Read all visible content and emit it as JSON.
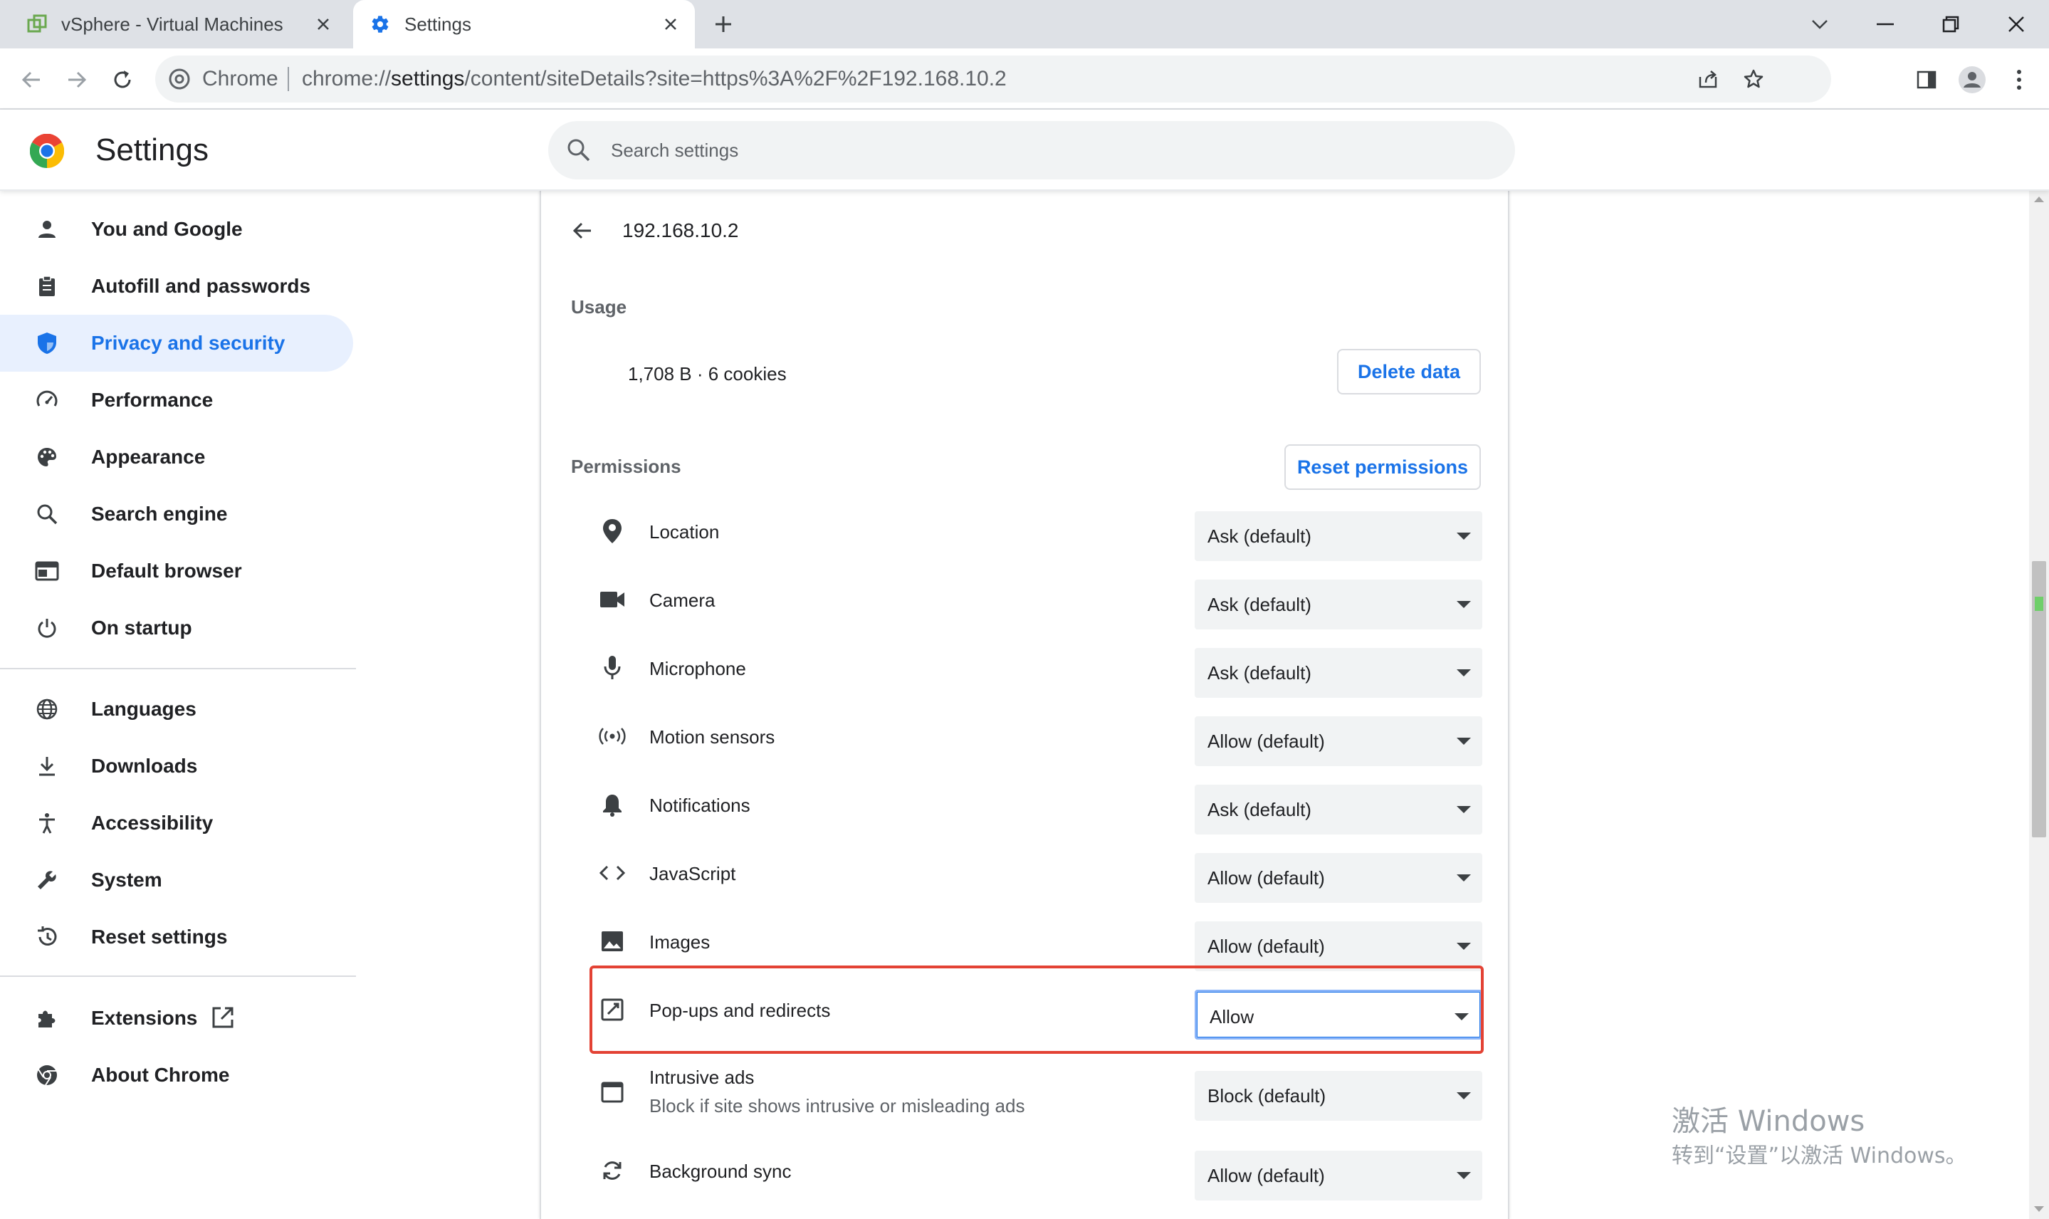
{
  "browser": {
    "tabs": [
      {
        "title": "vSphere - Virtual Machines",
        "icon": "vsphere-icon"
      },
      {
        "title": "Settings",
        "icon": "gear-icon"
      }
    ],
    "omnibox": {
      "chip": "Chrome",
      "url_host": "chrome://",
      "url_bold": "settings",
      "url_rest": "/content/siteDetails?site=https%3A%2F%2F192.168.10.2"
    }
  },
  "header": {
    "title": "Settings",
    "search_placeholder": "Search settings"
  },
  "sidebar": {
    "items": [
      {
        "label": "You and Google",
        "icon": "person-icon"
      },
      {
        "label": "Autofill and passwords",
        "icon": "clipboard-icon"
      },
      {
        "label": "Privacy and security",
        "icon": "shield-icon",
        "selected": true
      },
      {
        "label": "Performance",
        "icon": "speedometer-icon"
      },
      {
        "label": "Appearance",
        "icon": "palette-icon"
      },
      {
        "label": "Search engine",
        "icon": "search-icon"
      },
      {
        "label": "Default browser",
        "icon": "browser-window-icon"
      },
      {
        "label": "On startup",
        "icon": "power-icon"
      },
      {
        "label": "Languages",
        "icon": "globe-icon"
      },
      {
        "label": "Downloads",
        "icon": "download-icon"
      },
      {
        "label": "Accessibility",
        "icon": "accessibility-icon"
      },
      {
        "label": "System",
        "icon": "wrench-icon"
      },
      {
        "label": "Reset settings",
        "icon": "history-icon"
      },
      {
        "label": "Extensions",
        "icon": "puzzle-icon"
      },
      {
        "label": "About Chrome",
        "icon": "chrome-icon"
      }
    ]
  },
  "site": {
    "title": "192.168.10.2",
    "usage_heading": "Usage",
    "usage_text": "1,708 B · 6 cookies",
    "delete_button": "Delete data",
    "permissions_heading": "Permissions",
    "reset_button": "Reset permissions",
    "permissions": [
      {
        "label": "Location",
        "value": "Ask (default)",
        "icon": "location-pin-icon"
      },
      {
        "label": "Camera",
        "value": "Ask (default)",
        "icon": "camera-icon"
      },
      {
        "label": "Microphone",
        "value": "Ask (default)",
        "icon": "microphone-icon"
      },
      {
        "label": "Motion sensors",
        "value": "Allow (default)",
        "icon": "motion-sensors-icon"
      },
      {
        "label": "Notifications",
        "value": "Ask (default)",
        "icon": "bell-icon"
      },
      {
        "label": "JavaScript",
        "value": "Allow (default)",
        "icon": "code-icon"
      },
      {
        "label": "Images",
        "value": "Allow (default)",
        "icon": "image-icon"
      },
      {
        "label": "Pop-ups and redirects",
        "value": "Allow",
        "icon": "open-in-new-icon",
        "highlighted": true
      },
      {
        "label": "Intrusive ads",
        "sublabel": "Block if site shows intrusive or misleading ads",
        "value": "Block (default)",
        "icon": "ad-window-icon"
      },
      {
        "label": "Background sync",
        "value": "Allow (default)",
        "icon": "sync-icon"
      }
    ]
  },
  "watermark": {
    "line1": "激活 Windows",
    "line2": "转到“设置”以激活 Windows。"
  },
  "colors": {
    "accent": "#1a73e8",
    "selected_bg": "#e8f0fe",
    "highlight_border": "#e34234"
  }
}
